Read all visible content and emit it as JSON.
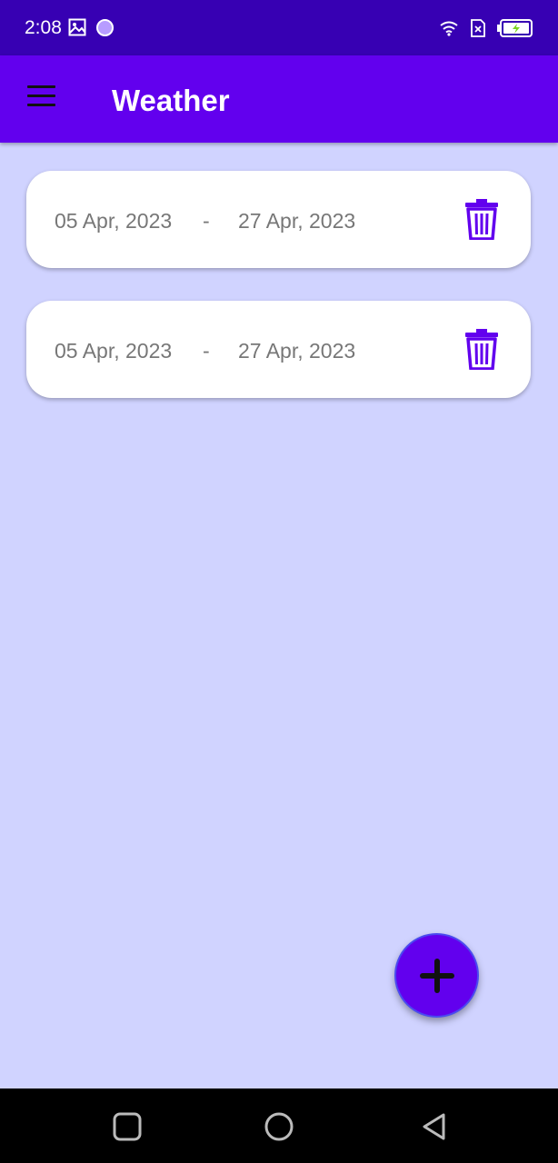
{
  "status_bar": {
    "time": "2:08",
    "icons": [
      "image-icon",
      "circle-notification-icon",
      "wifi-icon",
      "sim-off-icon",
      "battery-charging-icon"
    ]
  },
  "app_bar": {
    "title": "Weather",
    "menu_icon": "hamburger-menu-icon",
    "color": "#6200ee"
  },
  "ranges": [
    {
      "start": "05 Apr, 2023",
      "separator": "-",
      "end": "27 Apr, 2023",
      "action_icon": "trash-icon"
    },
    {
      "start": "05 Apr, 2023",
      "separator": "-",
      "end": "27 Apr, 2023",
      "action_icon": "trash-icon"
    }
  ],
  "fab": {
    "icon": "plus-icon"
  },
  "nav_bar": {
    "buttons": [
      "recents-square-icon",
      "home-circle-icon",
      "back-triangle-icon"
    ]
  },
  "colors": {
    "background": "#d0d3ff",
    "status_bar": "#3700b3",
    "accent": "#6200ee",
    "text_muted": "#777777"
  }
}
